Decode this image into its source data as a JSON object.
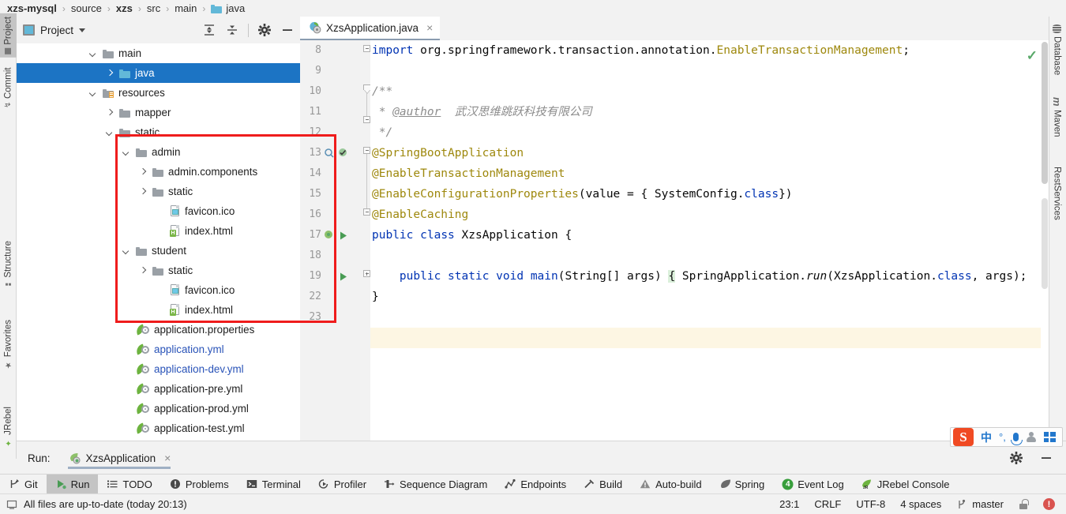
{
  "breadcrumb": {
    "items": [
      {
        "label": "xzs-mysql",
        "bold": true,
        "folder": false
      },
      {
        "label": "source",
        "bold": false,
        "folder": false
      },
      {
        "label": "xzs",
        "bold": true,
        "folder": false
      },
      {
        "label": "src",
        "bold": false,
        "folder": false
      },
      {
        "label": "main",
        "bold": false,
        "folder": false
      },
      {
        "label": "java",
        "bold": false,
        "folder": true
      }
    ],
    "separator": "›"
  },
  "left_tool_strip": {
    "tabs": [
      {
        "label": "Project",
        "icon": "project-icon",
        "selected": true
      },
      {
        "label": "Commit",
        "icon": "commit-icon",
        "selected": false
      },
      {
        "label": "Structure",
        "icon": "structure-icon",
        "selected": false
      },
      {
        "label": "Favorites",
        "icon": "star-icon",
        "selected": false
      },
      {
        "label": "JRebel",
        "icon": "jrebel-icon",
        "selected": false
      }
    ]
  },
  "right_tool_strip": {
    "tabs": [
      {
        "label": "Database",
        "icon": "database-icon"
      },
      {
        "label": "Maven",
        "icon": "maven-icon"
      },
      {
        "label": "RestServices",
        "icon": "rest-services-icon"
      }
    ]
  },
  "project_panel": {
    "title": "Project",
    "dropdown_icon": "chevron-down-icon",
    "toolbar": [
      {
        "name": "expand-all-button",
        "icon": "expand-all-icon"
      },
      {
        "name": "collapse-all-button",
        "icon": "collapse-all-icon"
      },
      {
        "name": "settings-button",
        "icon": "gear-icon"
      },
      {
        "name": "hide-button",
        "icon": "minimize-icon"
      }
    ],
    "tree": [
      {
        "label": "main",
        "indent": 4,
        "arrow": "down",
        "icon": "folder",
        "selected": false,
        "link": false
      },
      {
        "label": "java",
        "indent": 5,
        "arrow": "right",
        "icon": "folder-source",
        "selected": true,
        "link": false
      },
      {
        "label": "resources",
        "indent": 4,
        "arrow": "down",
        "icon": "folder-resources",
        "selected": false,
        "link": false
      },
      {
        "label": "mapper",
        "indent": 5,
        "arrow": "right",
        "icon": "folder",
        "selected": false,
        "link": false
      },
      {
        "label": "static",
        "indent": 5,
        "arrow": "down",
        "icon": "folder",
        "selected": false,
        "link": false
      },
      {
        "label": "admin",
        "indent": 6,
        "arrow": "down",
        "icon": "folder",
        "selected": false,
        "link": false
      },
      {
        "label": "admin.components",
        "indent": 7,
        "arrow": "right",
        "icon": "folder",
        "selected": false,
        "link": false
      },
      {
        "label": "static",
        "indent": 7,
        "arrow": "right",
        "icon": "folder",
        "selected": false,
        "link": false
      },
      {
        "label": "favicon.ico",
        "indent": 8,
        "arrow": "none",
        "icon": "image-file",
        "selected": false,
        "link": false
      },
      {
        "label": "index.html",
        "indent": 8,
        "arrow": "none",
        "icon": "html-file",
        "selected": false,
        "link": false
      },
      {
        "label": "student",
        "indent": 6,
        "arrow": "down",
        "icon": "folder",
        "selected": false,
        "link": false
      },
      {
        "label": "static",
        "indent": 7,
        "arrow": "right",
        "icon": "folder",
        "selected": false,
        "link": false
      },
      {
        "label": "favicon.ico",
        "indent": 8,
        "arrow": "none",
        "icon": "image-file",
        "selected": false,
        "link": false
      },
      {
        "label": "index.html",
        "indent": 8,
        "arrow": "none",
        "icon": "html-file",
        "selected": false,
        "link": false
      },
      {
        "label": "application.properties",
        "indent": 6,
        "arrow": "none",
        "icon": "spring-file",
        "selected": false,
        "link": false
      },
      {
        "label": "application.yml",
        "indent": 6,
        "arrow": "none",
        "icon": "spring-file",
        "selected": false,
        "link": true
      },
      {
        "label": "application-dev.yml",
        "indent": 6,
        "arrow": "none",
        "icon": "spring-file",
        "selected": false,
        "link": true
      },
      {
        "label": "application-pre.yml",
        "indent": 6,
        "arrow": "none",
        "icon": "spring-file",
        "selected": false,
        "link": false
      },
      {
        "label": "application-prod.yml",
        "indent": 6,
        "arrow": "none",
        "icon": "spring-file",
        "selected": false,
        "link": false
      },
      {
        "label": "application-test.yml",
        "indent": 6,
        "arrow": "none",
        "icon": "spring-file",
        "selected": false,
        "link": false
      }
    ],
    "annotation": {
      "color": "#ef1c1c",
      "shape": "rectangle"
    }
  },
  "editor": {
    "tab": {
      "label": "XzsApplication.java",
      "icon": "spring-boot-class-icon",
      "close_label": "×"
    },
    "inspection_status_icon": "check-ok-icon",
    "line_numbers": [
      "8",
      "9",
      "10",
      "11",
      "12",
      "13",
      "14",
      "15",
      "16",
      "17",
      "18",
      "19",
      "22",
      "23"
    ],
    "lines": [
      {
        "num": "8",
        "text": "import org.springframework.transaction.annotation.EnableTransactionManagement;"
      },
      {
        "num": "9",
        "text": ""
      },
      {
        "num": "10",
        "text": "/**"
      },
      {
        "num": "11",
        "text": " * @author 武汉思维跳跃科技有限公司"
      },
      {
        "num": "12",
        "text": " */"
      },
      {
        "num": "13",
        "text": "@SpringBootApplication"
      },
      {
        "num": "14",
        "text": "@EnableTransactionManagement"
      },
      {
        "num": "15",
        "text": "@EnableConfigurationProperties(value = { SystemConfig.class})"
      },
      {
        "num": "16",
        "text": "@EnableCaching"
      },
      {
        "num": "17",
        "text": "public class XzsApplication {"
      },
      {
        "num": "18",
        "text": ""
      },
      {
        "num": "19",
        "text": "    public static void main(String[] args) { SpringApplication.run(XzsApplication.class, args);"
      },
      {
        "num": "22",
        "text": "}"
      },
      {
        "num": "23",
        "text": ""
      }
    ],
    "code_tokens": {
      "import_kw": "import",
      "import_pkg": " org.springframework.transaction.annotation.",
      "import_cls": "EnableTransactionManagement",
      "semicolon": ";",
      "comment_open": "/**",
      "comment_star": " * ",
      "comment_author_tag": "@author",
      "comment_author_value": "  武汉思维跳跃科技有限公司",
      "comment_close": " */",
      "anno_springbootapplication": "@SpringBootApplication",
      "anno_enabletransactionmanagement": "@EnableTransactionManagement",
      "anno_enableconfigurationproperties": "@EnableConfigurationProperties",
      "anno_paren_open": "(",
      "anno_value_eq": "value = { SystemConfig.",
      "anno_class_kw": "class",
      "anno_paren_close": "})",
      "anno_enablecaching": "@EnableCaching",
      "kw_public": "public",
      "kw_class": "class",
      "classname": "XzsApplication",
      "brace_open": "{",
      "kw_static": "static",
      "kw_void": "void",
      "method_main": "main",
      "main_params": "(String[] args) ",
      "main_body_brace": "{",
      "springapplication": " SpringApplication.",
      "run_method": "run",
      "run_args": "(XzsApplication.",
      "run_class_kw": "class",
      "run_tail": ", args);",
      "brace_close": "}"
    }
  },
  "run_panel": {
    "label": "Run:",
    "tab": {
      "label": "XzsApplication",
      "icon": "spring-boot-run-icon",
      "close_label": "×"
    },
    "tools": [
      {
        "name": "settings-button",
        "icon": "gear-icon"
      },
      {
        "name": "hide-button",
        "icon": "minimize-icon"
      }
    ]
  },
  "bottom_toolbar": {
    "items": [
      {
        "label": "Git",
        "icon": "git-branch-icon",
        "active": false
      },
      {
        "label": "Run",
        "icon": "run-play-icon",
        "active": true
      },
      {
        "label": "TODO",
        "icon": "todo-list-icon",
        "active": false
      },
      {
        "label": "Problems",
        "icon": "problems-warning-icon",
        "active": false
      },
      {
        "label": "Terminal",
        "icon": "terminal-icon",
        "active": false
      },
      {
        "label": "Profiler",
        "icon": "profiler-icon",
        "active": false
      },
      {
        "label": "Sequence Diagram",
        "icon": "sequence-diagram-icon",
        "active": false
      },
      {
        "label": "Endpoints",
        "icon": "endpoints-icon",
        "active": false
      },
      {
        "label": "Build",
        "icon": "build-hammer-icon",
        "active": false
      },
      {
        "label": "Auto-build",
        "icon": "auto-build-icon",
        "active": false
      },
      {
        "label": "Spring",
        "icon": "spring-leaf-icon",
        "active": false
      },
      {
        "label": "Event Log",
        "icon": "event-log-icon",
        "badge": "4",
        "active": false
      },
      {
        "label": "JRebel Console",
        "icon": "jrebel-icon",
        "active": false
      }
    ]
  },
  "status_bar": {
    "message": "All files are up-to-date (today 20:13)",
    "message_icon": "document-icon",
    "caret_position": "23:1",
    "line_separator": "CRLF",
    "encoding": "UTF-8",
    "indent": "4 spaces",
    "branch": "master",
    "branch_icon": "git-branch-icon",
    "lock_icon": "lock-icon",
    "error_badge": "!"
  },
  "ime_bar": {
    "logo": "S",
    "mode_label": "中",
    "punctuation_label": "°,",
    "items": [
      {
        "name": "sogou-logo",
        "icon": "sogou-icon"
      },
      {
        "name": "input-mode-chinese",
        "icon": "chinese-mode-icon"
      },
      {
        "name": "punctuation-toggle",
        "icon": "punctuation-icon"
      },
      {
        "name": "voice-input",
        "icon": "microphone-icon"
      },
      {
        "name": "user-profile",
        "icon": "person-icon"
      },
      {
        "name": "toolbox",
        "icon": "grid-icon"
      }
    ]
  },
  "colors": {
    "selection_blue": "#1c74c4",
    "annotation_red": "#ef1c1c",
    "keyword_blue": "#0033b3",
    "annotation_gold": "#9e880d",
    "panel_gray": "#f2f2f2",
    "spring_green": "#6db33f"
  }
}
